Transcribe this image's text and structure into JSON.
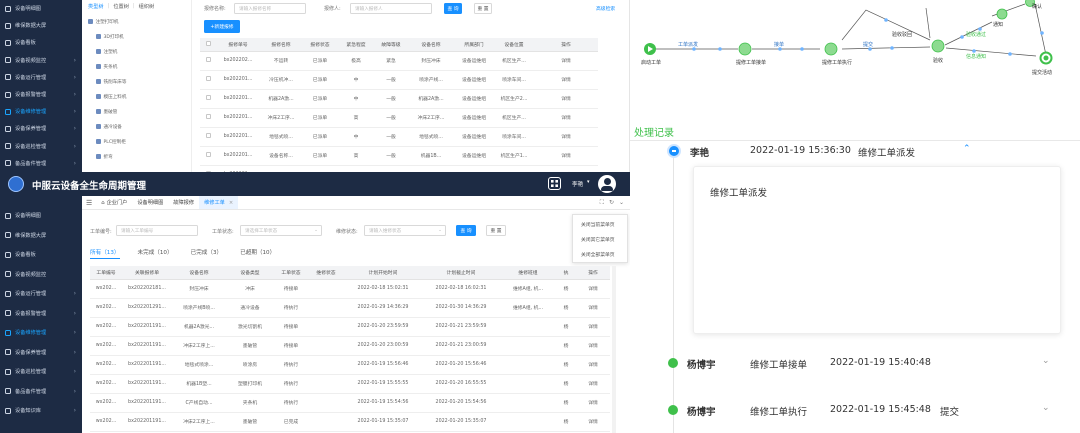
{
  "colors": {
    "sidebar_bg": "#1d2b44",
    "accent": "#1890ff",
    "flow_green": "#3fc04b",
    "flow_green_light": "#8ddb90",
    "flow_blue_text": "#2b71c3"
  },
  "panel1": {
    "sidebar": {
      "items": [
        {
          "label": "设备明细图",
          "icon": "home-icon"
        },
        {
          "label": "维保数据大屏",
          "icon": "dashboard-icon"
        },
        {
          "label": "设备看板",
          "icon": "board-icon"
        },
        {
          "label": "设备视频监控",
          "icon": "video-icon"
        },
        {
          "label": "设备运行管理",
          "icon": "run-icon"
        },
        {
          "label": "设备报警管理",
          "icon": "alarm-icon"
        },
        {
          "label": "设备维修管理",
          "icon": "wrench-icon"
        },
        {
          "label": "设备保养管理",
          "icon": "maintain-icon"
        },
        {
          "label": "设备巡检管理",
          "icon": "inspect-icon"
        },
        {
          "label": "备品备件管理",
          "icon": "parts-icon"
        }
      ]
    },
    "tree": {
      "tabs": [
        "类型树",
        "位置树",
        "组织树"
      ],
      "items": [
        "注塑打印机",
        "3D打印机",
        "注塑机",
        "夹条机",
        "铣削车床等",
        "模压上料机",
        "墨破管",
        "通冷设备",
        "PLC控制柜",
        "折弯"
      ]
    },
    "filters": [
      {
        "label": "报修名称:",
        "placeholder": "请输入报修名称"
      },
      {
        "label": "报修人:",
        "placeholder": "请输入报修人"
      }
    ],
    "query_label": "查 询",
    "reset_label": "重 置",
    "more_label": "高级检索",
    "new_button": "+新建报修",
    "columns": [
      "报修单号",
      "报修名称",
      "报修状态",
      "紧急程度",
      "故障等级",
      "设备名称",
      "所属部门",
      "设备位置",
      "操作"
    ],
    "rows": [
      [
        "bx202202...",
        "不运转",
        "已派单",
        "极高",
        "紧急",
        "封压冲床",
        "设备运维组",
        "机区生产..."
      ],
      [
        "bx202201...",
        "冷压机冲...",
        "已派单",
        "中",
        "一般",
        "喷涂产线...",
        "设备运维组",
        "喷涂车间..."
      ],
      [
        "bx202201...",
        "机器2A激...",
        "已派单",
        "中",
        "一般",
        "机器2A激...",
        "设备运维组",
        "机区生产2..."
      ],
      [
        "bx202201...",
        "冲床2工序...",
        "已派单",
        "高",
        "一般",
        "冲床2工序...",
        "设备运维组",
        "机区生产..."
      ],
      [
        "bx202201...",
        "地毯式喷...",
        "已派单",
        "中",
        "一般",
        "地毯式喷...",
        "设备运维组",
        "喷涂车间..."
      ],
      [
        "bx202201...",
        "设备名称...",
        "已派单",
        "高",
        "一般",
        "机器1B...",
        "设备运维组",
        "机区生产1..."
      ],
      [
        "bx202201...",
        "C产线自...",
        "已派单",
        "中",
        "一般",
        "C产线自...",
        "设备运维组",
        "纸芯生产..."
      ]
    ],
    "op_label": "详情"
  },
  "panel2": {
    "app_title": "中服云设备全生命周期管理",
    "user_name": "李艳",
    "sidebar": {
      "items": [
        "设备明细图",
        "维保数据大屏",
        "设备看板",
        "设备视频监控",
        "设备运行管理",
        "设备报警管理",
        "设备维修管理",
        "设备保养管理",
        "设备巡检管理",
        "备品备件管理",
        "设备知识库"
      ]
    },
    "nav_tabs": [
      {
        "label": "企业门户",
        "icon": "home-icon"
      },
      {
        "label": "设备明细图"
      },
      {
        "label": "故障报修"
      },
      {
        "label": "维修工单"
      }
    ],
    "filters": [
      {
        "label": "工单编号:",
        "placeholder": "请输入工单编号"
      },
      {
        "label": "工单状态:",
        "placeholder": "请选择工单状态"
      },
      {
        "label": "维修状态:",
        "placeholder": "请输入维修状态"
      }
    ],
    "query_label": "查 询",
    "reset_label": "重 置",
    "status_tabs": [
      "所有（13）",
      "未完成（10）",
      "已完成（3）",
      "已超期（10）"
    ],
    "context_menu": [
      "关闭当前菜单页",
      "关闭其它菜单页",
      "关闭全部菜单页"
    ],
    "columns": [
      "工单编号",
      "关联报修单",
      "设备名称",
      "设备类型",
      "工单状态",
      "维修状态",
      "计划开始时间",
      "计划截止时间",
      "维修班组",
      "执",
      "操作"
    ],
    "rows": [
      [
        "wx202...",
        "bx202202181...",
        "封压冲床",
        "冲床",
        "待接单",
        "",
        "2022-02-18 15:02:31",
        "2022-02-18 16:02:31",
        "维修A组, 机...",
        "杨"
      ],
      [
        "wx202...",
        "bx202201291...",
        "喷涂产线B喷...",
        "通冷设备",
        "待执行",
        "",
        "2022-01-29 14:36:29",
        "2022-01-30 14:36:29",
        "维修A组, 机...",
        "杨"
      ],
      [
        "wx202...",
        "bx202201191...",
        "机器2A激光...",
        "激光切割机",
        "待接单",
        "",
        "2022-01-20 23:59:59",
        "2022-01-21 23:59:59",
        "",
        "杨"
      ],
      [
        "wx202...",
        "bx202201191...",
        "冲床2工序上...",
        "墨破管",
        "待接单",
        "",
        "2022-01-20 23:00:59",
        "2022-01-21 23:00:59",
        "",
        "杨"
      ],
      [
        "wx202...",
        "bx202201191...",
        "地毯式喷涂...",
        "喷涂房",
        "待执行",
        "",
        "2022-01-19 15:56:46",
        "2022-01-20 15:56:46",
        "",
        "杨"
      ],
      [
        "wx202...",
        "bx202201191...",
        "机器1B塑...",
        "塑膜打印机",
        "待执行",
        "",
        "2022-01-19 15:55:55",
        "2022-01-20 16:55:55",
        "",
        "杨"
      ],
      [
        "wx202...",
        "bx202201191...",
        "C产线自动...",
        "夹条机",
        "待执行",
        "",
        "2022-01-19 15:54:56",
        "2022-01-20 15:54:56",
        "",
        "杨"
      ],
      [
        "wx202...",
        "bx202201191...",
        "冲床2工序上...",
        "墨破管",
        "已完成",
        "",
        "2022-01-19 15:35:07",
        "2022-01-20 15:35:07",
        "",
        "杨"
      ],
      [
        "wx202...",
        "bx202201181...",
        "纸芯生产...",
        "PLC控制柜",
        "已完成",
        "维修完成",
        "2022-01-20 14:00:00",
        "2022-01-20 15:00:00",
        "",
        "杨"
      ]
    ],
    "op_label": "详情"
  },
  "panel3": {
    "flow": {
      "nodes": [
        "启动工单",
        "提修工单接单",
        "提修工单执行",
        "验收",
        "提交活动",
        "通知",
        "确认"
      ],
      "edges": [
        "工单派发",
        "接单",
        "提交",
        "验收驳回",
        "验收通过",
        "信息通知"
      ]
    },
    "section_title": "处理记录",
    "records": [
      {
        "name": "李艳",
        "time": "2022-01-19 15:36:30",
        "action": "维修工单派发",
        "detail": "维修工单派发"
      },
      {
        "name": "杨博宇",
        "time": "2022-01-19 15:40:48",
        "action": "维修工单接单"
      },
      {
        "name": "杨博宇",
        "time": "2022-01-19 15:45:48",
        "action": "维修工单执行",
        "result": "提交"
      }
    ]
  }
}
